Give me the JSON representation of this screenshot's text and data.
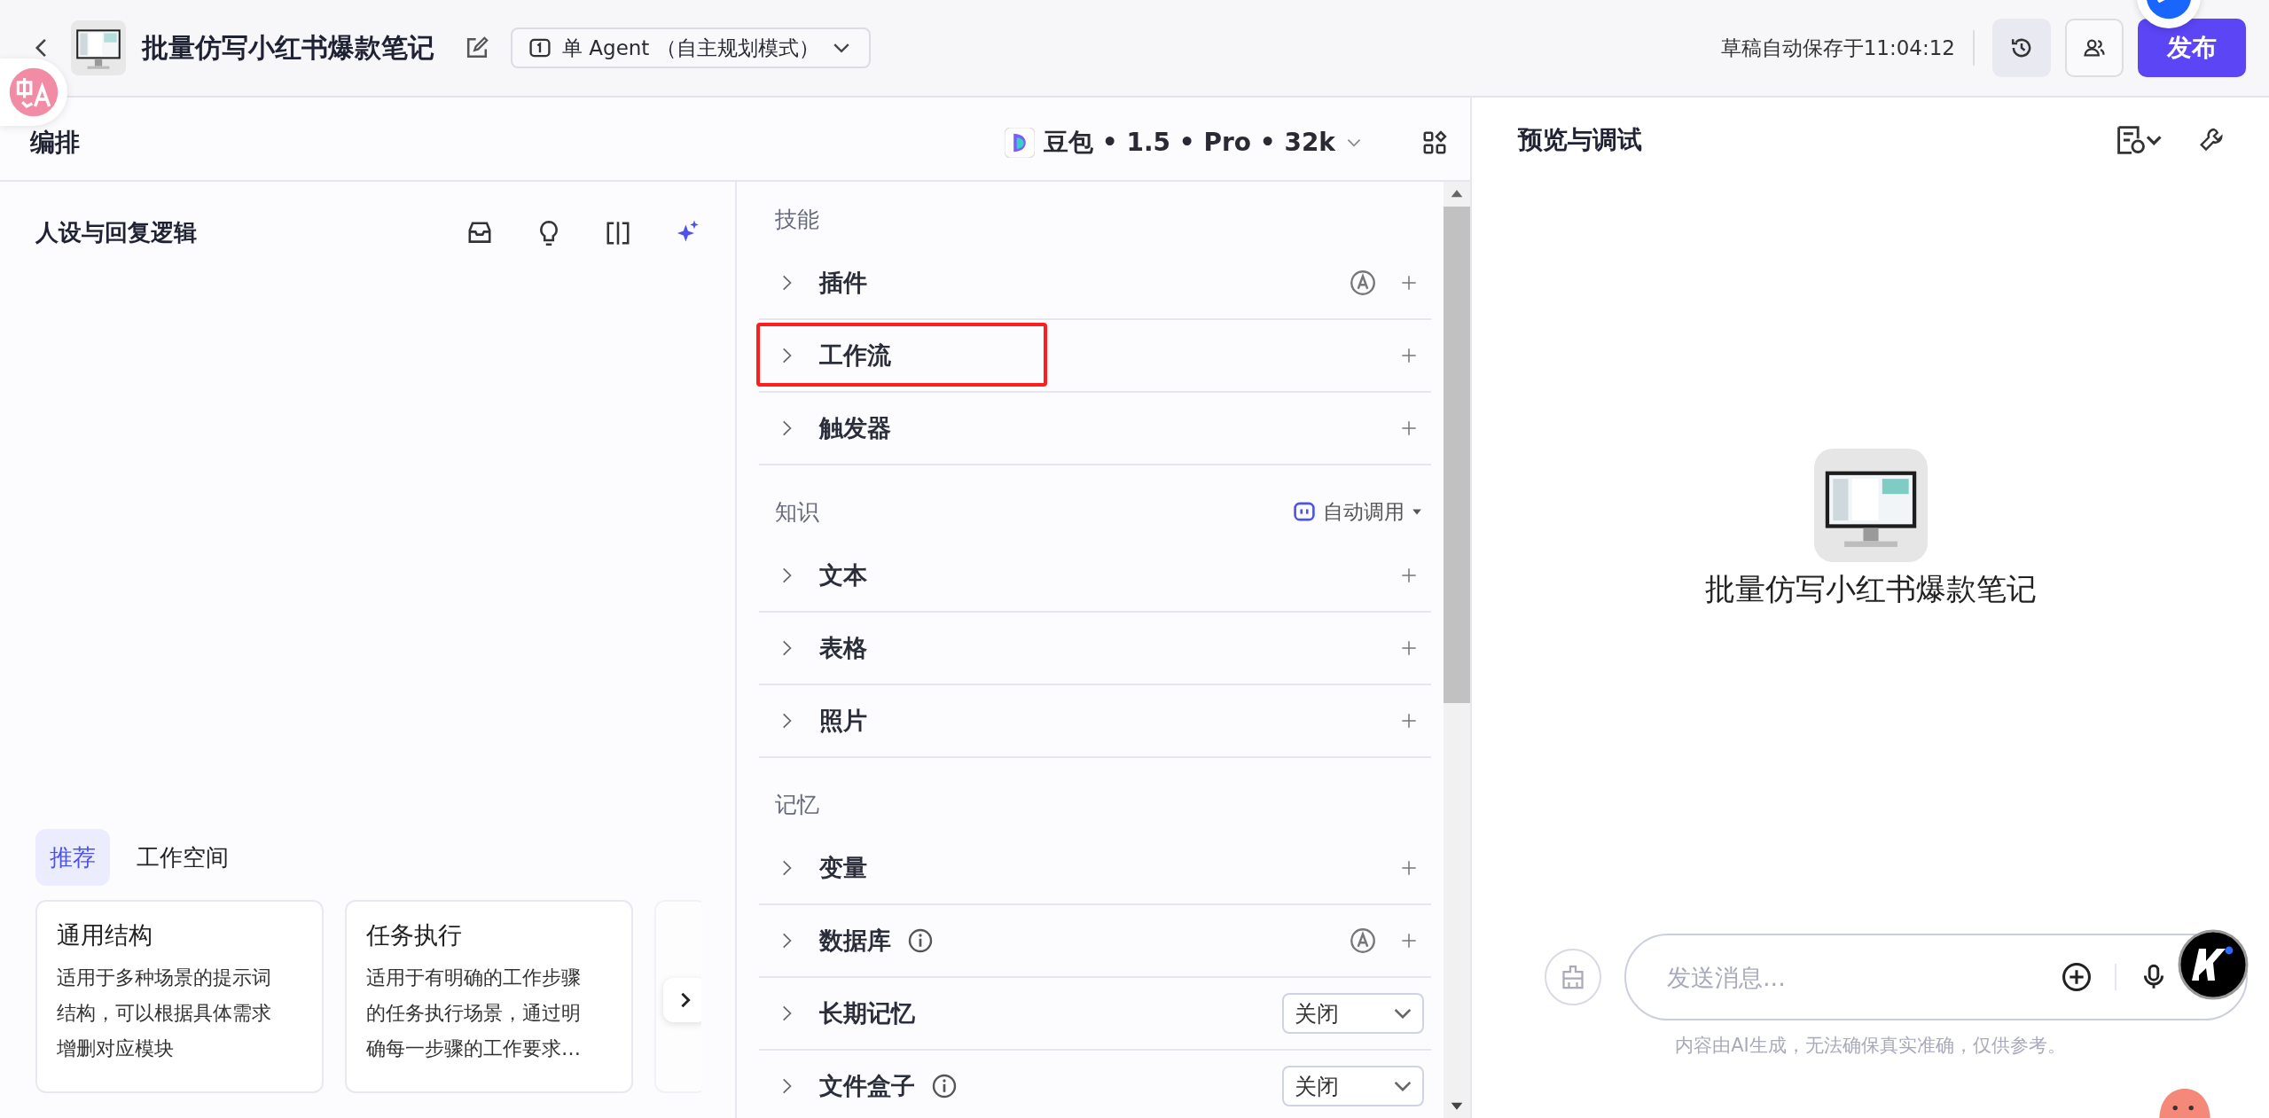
{
  "header": {
    "title": "批量仿写小红书爆款笔记",
    "mode": "单 Agent （自主规划模式）",
    "save_status": "草稿自动保存于11:04:12",
    "publish": "发布"
  },
  "editor": {
    "title": "编排",
    "model": "豆包 • 1.5 • Pro • 32k"
  },
  "persona": {
    "title": "人设与回复逻辑",
    "template_tabs": [
      {
        "label": "推荐",
        "selected": true
      },
      {
        "label": "工作空间",
        "selected": false
      }
    ],
    "templates": [
      {
        "title": "通用结构",
        "description": "适用于多种场景的提示词结构，可以根据具体需求增删对应模块"
      },
      {
        "title": "任务执行",
        "description": "适用于有明确的工作步骤的任务执行场景，通过明确每一步骤的工作要求…"
      }
    ]
  },
  "sections": [
    {
      "title": "技能",
      "items": [
        {
          "label": "插件",
          "kind": "add",
          "auto": true,
          "info": false,
          "highlighted": false
        },
        {
          "label": "工作流",
          "kind": "add",
          "auto": false,
          "info": false,
          "highlighted": true
        },
        {
          "label": "触发器",
          "kind": "add",
          "auto": false,
          "info": false,
          "highlighted": false
        }
      ]
    },
    {
      "title": "知识",
      "action": "自动调用",
      "items": [
        {
          "label": "文本",
          "kind": "add",
          "auto": false,
          "info": false,
          "highlighted": false
        },
        {
          "label": "表格",
          "kind": "add",
          "auto": false,
          "info": false,
          "highlighted": false
        },
        {
          "label": "照片",
          "kind": "add",
          "auto": false,
          "info": false,
          "highlighted": false
        }
      ]
    },
    {
      "title": "记忆",
      "items": [
        {
          "label": "变量",
          "kind": "add",
          "auto": false,
          "info": false,
          "highlighted": false
        },
        {
          "label": "数据库",
          "kind": "add",
          "auto": true,
          "info": true,
          "highlighted": false
        },
        {
          "label": "长期记忆",
          "kind": "select",
          "value": "关闭",
          "auto": false,
          "info": false,
          "highlighted": false
        },
        {
          "label": "文件盒子",
          "kind": "select",
          "value": "关闭",
          "auto": false,
          "info": true,
          "highlighted": false
        }
      ]
    }
  ],
  "preview": {
    "title": "预览与调试",
    "bot_name": "批量仿写小红书爆款笔记",
    "input": {
      "placeholder": "发送消息..."
    },
    "disclaimer": "内容由AI生成，无法确保真实准确，仅供参考。"
  }
}
